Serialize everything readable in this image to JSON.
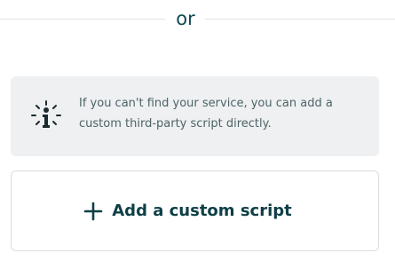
{
  "divider": {
    "text": "or"
  },
  "info": {
    "icon": "info-sparkle-icon",
    "message": "If you can't find your service, you can add a custom third-party script directly."
  },
  "add_button": {
    "icon": "plus-icon",
    "label": "Add a custom script"
  },
  "colors": {
    "primary_text": "#0e3f46",
    "info_text": "#4d6367",
    "info_background": "#eef0f1",
    "border": "#d8dde0",
    "divider_line": "#dfe3e6"
  }
}
